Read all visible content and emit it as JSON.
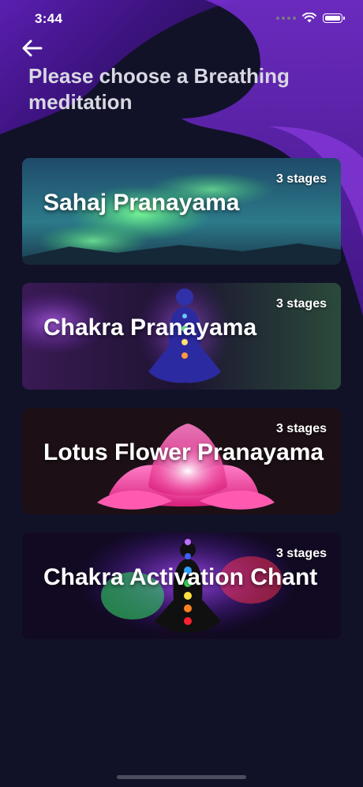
{
  "status_bar": {
    "time": "3:44"
  },
  "header": {
    "title": "Please choose a Breathing meditation"
  },
  "meditations": [
    {
      "title": "Sahaj Pranayama",
      "stages": "3 stages",
      "art": "aurora"
    },
    {
      "title": "Chakra Pranayama",
      "stages": "3 stages",
      "art": "meditating-figure"
    },
    {
      "title": "Lotus Flower Pranayama",
      "stages": "3 stages",
      "art": "lotus-flower"
    },
    {
      "title": "Chakra Activation Chant",
      "stages": "3 stages",
      "art": "chakra-figure"
    }
  ],
  "colors": {
    "background": "#111228",
    "accent": "#6a24c8",
    "title_text": "#d8d8e2"
  }
}
